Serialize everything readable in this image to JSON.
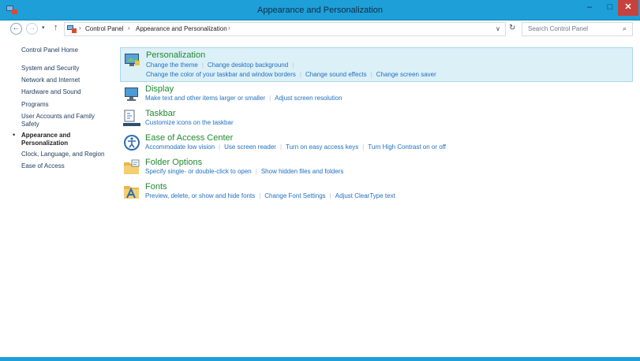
{
  "window": {
    "title": "Appearance and Personalization",
    "min_label": "–",
    "max_label": "□",
    "close_label": "✕"
  },
  "nav": {
    "back": "←",
    "forward": "→",
    "dropdown": "▾",
    "up": "↑",
    "breadcrumbs": [
      "Control Panel",
      "Appearance and Personalization"
    ],
    "sep": "›",
    "refresh": "↻",
    "addr_dropdown": "∨"
  },
  "search": {
    "placeholder": "Search Control Panel",
    "icon": "⌕"
  },
  "sidebar": {
    "items": [
      {
        "label": "Control Panel Home"
      },
      {
        "label": "System and Security"
      },
      {
        "label": "Network and Internet"
      },
      {
        "label": "Hardware and Sound"
      },
      {
        "label": "Programs"
      },
      {
        "label": "User Accounts and Family",
        "label2": "Safety"
      },
      {
        "label": "Appearance and",
        "label2": "Personalization",
        "current": true
      },
      {
        "label": "Clock, Language, and Region"
      },
      {
        "label": "Ease of Access"
      }
    ],
    "bullet": "•"
  },
  "categories": [
    {
      "title": "Personalization",
      "icon": "personalization-icon",
      "links": [
        [
          "Change the theme",
          "Change desktop background"
        ],
        [
          "Change the color of your taskbar and window borders",
          "Change sound effects",
          "Change screen saver"
        ]
      ]
    },
    {
      "title": "Display",
      "icon": "display-icon",
      "links": [
        [
          "Make text and other items larger or smaller",
          "Adjust screen resolution"
        ]
      ]
    },
    {
      "title": "Taskbar",
      "icon": "taskbar-icon",
      "links": [
        [
          "Customize icons on the taskbar"
        ]
      ]
    },
    {
      "title": "Ease of Access Center",
      "icon": "ease-of-access-icon",
      "links": [
        [
          "Accommodate low vision",
          "Use screen reader",
          "Turn on easy access keys",
          "Turn High Contrast on or off"
        ]
      ]
    },
    {
      "title": "Folder Options",
      "icon": "folder-options-icon",
      "links": [
        [
          "Specify single- or double-click to open",
          "Show hidden files and folders"
        ]
      ]
    },
    {
      "title": "Fonts",
      "icon": "fonts-icon",
      "links": [
        [
          "Preview, delete, or show and hide fonts",
          "Change Font Settings",
          "Adjust ClearType text"
        ]
      ]
    }
  ],
  "colors": {
    "titlebar": "#1e9fd8",
    "link": "#1f6fbf",
    "category_title": "#1d8b2e",
    "highlight": "#dcf0f7",
    "close": "#c7413e"
  }
}
